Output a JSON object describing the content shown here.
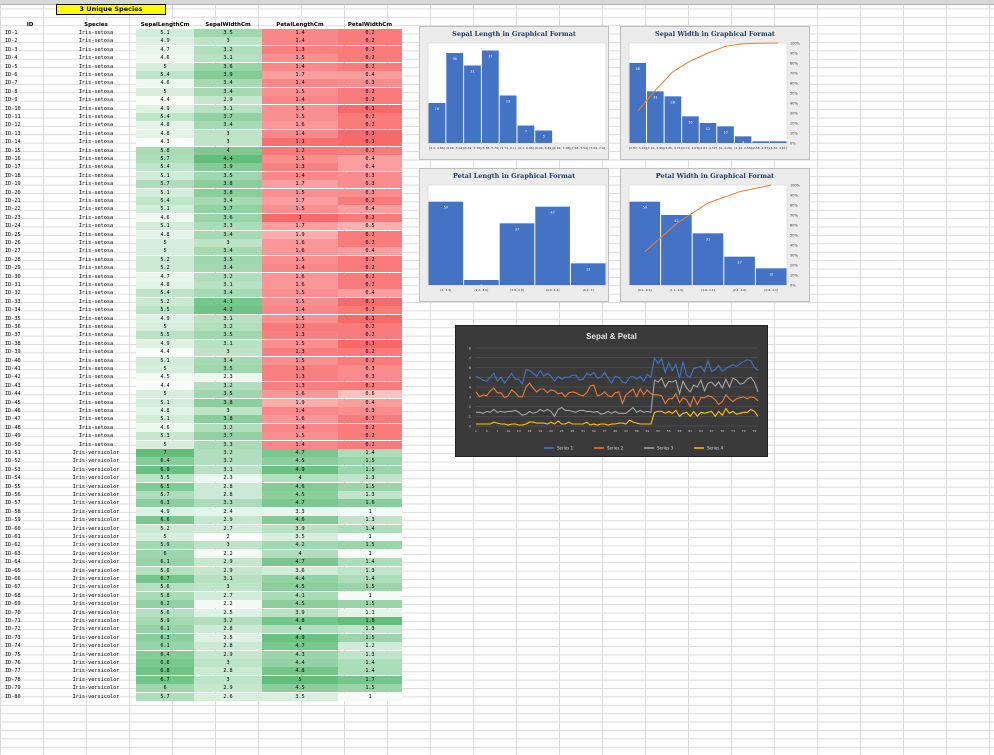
{
  "sheet": {
    "badge": "3 Unique Species",
    "headers": [
      "ID",
      "Species",
      "SepalLengthCm",
      "SepalWidthCm",
      "PetalLengthCm",
      "PetalWidthCm"
    ],
    "rows": [
      [
        "ID-1",
        "Iris-setosa",
        "5.1",
        "3.5",
        "1.4",
        "0.2"
      ],
      [
        "ID-2",
        "Iris-setosa",
        "4.9",
        "3",
        "1.4",
        "0.2"
      ],
      [
        "ID-3",
        "Iris-setosa",
        "4.7",
        "3.2",
        "1.3",
        "0.2"
      ],
      [
        "ID-4",
        "Iris-setosa",
        "4.6",
        "3.1",
        "1.5",
        "0.2"
      ],
      [
        "ID-5",
        "Iris-setosa",
        "5",
        "3.6",
        "1.4",
        "0.2"
      ],
      [
        "ID-6",
        "Iris-setosa",
        "5.4",
        "3.9",
        "1.7",
        "0.4"
      ],
      [
        "ID-7",
        "Iris-setosa",
        "4.6",
        "3.4",
        "1.4",
        "0.3"
      ],
      [
        "ID-8",
        "Iris-setosa",
        "5",
        "3.4",
        "1.5",
        "0.2"
      ],
      [
        "ID-9",
        "Iris-setosa",
        "4.4",
        "2.9",
        "1.4",
        "0.2"
      ],
      [
        "ID-10",
        "Iris-setosa",
        "4.9",
        "3.1",
        "1.5",
        "0.1"
      ],
      [
        "ID-11",
        "Iris-setosa",
        "5.4",
        "3.7",
        "1.5",
        "0.2"
      ],
      [
        "ID-12",
        "Iris-setosa",
        "4.8",
        "3.4",
        "1.6",
        "0.2"
      ],
      [
        "ID-13",
        "Iris-setosa",
        "4.8",
        "3",
        "1.4",
        "0.1"
      ],
      [
        "ID-14",
        "Iris-setosa",
        "4.3",
        "3",
        "1.1",
        "0.1"
      ],
      [
        "ID-15",
        "Iris-setosa",
        "5.8",
        "4",
        "1.2",
        "0.2"
      ],
      [
        "ID-16",
        "Iris-setosa",
        "5.7",
        "4.4",
        "1.5",
        "0.4"
      ],
      [
        "ID-17",
        "Iris-setosa",
        "5.4",
        "3.9",
        "1.3",
        "0.4"
      ],
      [
        "ID-18",
        "Iris-setosa",
        "5.1",
        "3.5",
        "1.4",
        "0.3"
      ],
      [
        "ID-19",
        "Iris-setosa",
        "5.7",
        "3.8",
        "1.7",
        "0.3"
      ],
      [
        "ID-20",
        "Iris-setosa",
        "5.1",
        "3.8",
        "1.5",
        "0.3"
      ],
      [
        "ID-21",
        "Iris-setosa",
        "5.4",
        "3.4",
        "1.7",
        "0.2"
      ],
      [
        "ID-22",
        "Iris-setosa",
        "5.1",
        "3.7",
        "1.5",
        "0.4"
      ],
      [
        "ID-23",
        "Iris-setosa",
        "4.6",
        "3.6",
        "1",
        "0.2"
      ],
      [
        "ID-24",
        "Iris-setosa",
        "5.1",
        "3.3",
        "1.7",
        "0.5"
      ],
      [
        "ID-25",
        "Iris-setosa",
        "4.8",
        "3.4",
        "1.9",
        "0.2"
      ],
      [
        "ID-26",
        "Iris-setosa",
        "5",
        "3",
        "1.6",
        "0.2"
      ],
      [
        "ID-27",
        "Iris-setosa",
        "5",
        "3.4",
        "1.6",
        "0.4"
      ],
      [
        "ID-28",
        "Iris-setosa",
        "5.2",
        "3.5",
        "1.5",
        "0.2"
      ],
      [
        "ID-29",
        "Iris-setosa",
        "5.2",
        "3.4",
        "1.4",
        "0.2"
      ],
      [
        "ID-30",
        "Iris-setosa",
        "4.7",
        "3.2",
        "1.6",
        "0.2"
      ],
      [
        "ID-31",
        "Iris-setosa",
        "4.8",
        "3.1",
        "1.6",
        "0.2"
      ],
      [
        "ID-32",
        "Iris-setosa",
        "5.4",
        "3.4",
        "1.5",
        "0.4"
      ],
      [
        "ID-33",
        "Iris-setosa",
        "5.2",
        "4.1",
        "1.5",
        "0.1"
      ],
      [
        "ID-34",
        "Iris-setosa",
        "5.5",
        "4.2",
        "1.4",
        "0.2"
      ],
      [
        "ID-35",
        "Iris-setosa",
        "4.9",
        "3.1",
        "1.5",
        "0.1"
      ],
      [
        "ID-36",
        "Iris-setosa",
        "5",
        "3.2",
        "1.2",
        "0.2"
      ],
      [
        "ID-37",
        "Iris-setosa",
        "5.5",
        "3.5",
        "1.3",
        "0.2"
      ],
      [
        "ID-38",
        "Iris-setosa",
        "4.9",
        "3.1",
        "1.5",
        "0.1"
      ],
      [
        "ID-39",
        "Iris-setosa",
        "4.4",
        "3",
        "1.3",
        "0.2"
      ],
      [
        "ID-40",
        "Iris-setosa",
        "5.1",
        "3.4",
        "1.5",
        "0.2"
      ],
      [
        "ID-41",
        "Iris-setosa",
        "5",
        "3.5",
        "1.3",
        "0.3"
      ],
      [
        "ID-42",
        "Iris-setosa",
        "4.5",
        "2.3",
        "1.3",
        "0.3"
      ],
      [
        "ID-43",
        "Iris-setosa",
        "4.4",
        "3.2",
        "1.3",
        "0.2"
      ],
      [
        "ID-44",
        "Iris-setosa",
        "5",
        "3.5",
        "1.6",
        "0.6"
      ],
      [
        "ID-45",
        "Iris-setosa",
        "5.1",
        "3.8",
        "1.9",
        "0.4"
      ],
      [
        "ID-46",
        "Iris-setosa",
        "4.8",
        "3",
        "1.4",
        "0.3"
      ],
      [
        "ID-47",
        "Iris-setosa",
        "5.1",
        "3.8",
        "1.6",
        "0.2"
      ],
      [
        "ID-48",
        "Iris-setosa",
        "4.6",
        "3.2",
        "1.4",
        "0.2"
      ],
      [
        "ID-49",
        "Iris-setosa",
        "5.3",
        "3.7",
        "1.5",
        "0.2"
      ],
      [
        "ID-50",
        "Iris-setosa",
        "5",
        "3.3",
        "1.4",
        "0.2"
      ],
      [
        "ID-51",
        "Iris-versicolor",
        "7",
        "3.2",
        "4.7",
        "1.4"
      ],
      [
        "ID-52",
        "Iris-versicolor",
        "6.4",
        "3.2",
        "4.5",
        "1.5"
      ],
      [
        "ID-53",
        "Iris-versicolor",
        "6.9",
        "3.1",
        "4.9",
        "1.5"
      ],
      [
        "ID-54",
        "Iris-versicolor",
        "5.5",
        "2.3",
        "4",
        "1.3"
      ],
      [
        "ID-55",
        "Iris-versicolor",
        "6.5",
        "2.8",
        "4.6",
        "1.5"
      ],
      [
        "ID-56",
        "Iris-versicolor",
        "5.7",
        "2.8",
        "4.5",
        "1.3"
      ],
      [
        "ID-57",
        "Iris-versicolor",
        "6.3",
        "3.3",
        "4.7",
        "1.6"
      ],
      [
        "ID-58",
        "Iris-versicolor",
        "4.9",
        "2.4",
        "3.3",
        "1"
      ],
      [
        "ID-59",
        "Iris-versicolor",
        "6.6",
        "2.9",
        "4.6",
        "1.3"
      ],
      [
        "ID-60",
        "Iris-versicolor",
        "5.2",
        "2.7",
        "3.9",
        "1.4"
      ],
      [
        "ID-61",
        "Iris-versicolor",
        "5",
        "2",
        "3.5",
        "1"
      ],
      [
        "ID-62",
        "Iris-versicolor",
        "5.9",
        "3",
        "4.2",
        "1.5"
      ],
      [
        "ID-63",
        "Iris-versicolor",
        "6",
        "2.2",
        "4",
        "1"
      ],
      [
        "ID-64",
        "Iris-versicolor",
        "6.1",
        "2.9",
        "4.7",
        "1.4"
      ],
      [
        "ID-65",
        "Iris-versicolor",
        "5.6",
        "2.9",
        "3.6",
        "1.3"
      ],
      [
        "ID-66",
        "Iris-versicolor",
        "6.7",
        "3.1",
        "4.4",
        "1.4"
      ],
      [
        "ID-67",
        "Iris-versicolor",
        "5.6",
        "3",
        "4.5",
        "1.5"
      ],
      [
        "ID-68",
        "Iris-versicolor",
        "5.8",
        "2.7",
        "4.1",
        "1"
      ],
      [
        "ID-69",
        "Iris-versicolor",
        "6.2",
        "2.2",
        "4.5",
        "1.5"
      ],
      [
        "ID-70",
        "Iris-versicolor",
        "5.6",
        "2.5",
        "3.9",
        "1.1"
      ],
      [
        "ID-71",
        "Iris-versicolor",
        "5.9",
        "3.2",
        "4.8",
        "1.8"
      ],
      [
        "ID-72",
        "Iris-versicolor",
        "6.1",
        "2.8",
        "4",
        "1.3"
      ],
      [
        "ID-73",
        "Iris-versicolor",
        "6.3",
        "2.5",
        "4.9",
        "1.5"
      ],
      [
        "ID-74",
        "Iris-versicolor",
        "6.1",
        "2.8",
        "4.7",
        "1.2"
      ],
      [
        "ID-75",
        "Iris-versicolor",
        "6.4",
        "2.9",
        "4.3",
        "1.3"
      ],
      [
        "ID-76",
        "Iris-versicolor",
        "6.6",
        "3",
        "4.4",
        "1.4"
      ],
      [
        "ID-77",
        "Iris-versicolor",
        "6.8",
        "2.8",
        "4.8",
        "1.4"
      ],
      [
        "ID-78",
        "Iris-versicolor",
        "6.7",
        "3",
        "5",
        "1.7"
      ],
      [
        "ID-79",
        "Iris-versicolor",
        "6",
        "2.9",
        "4.5",
        "1.5"
      ],
      [
        "ID-80",
        "Iris-versicolor",
        "5.7",
        "2.6",
        "3.5",
        "1"
      ]
    ]
  },
  "chart_data": [
    {
      "type": "bar",
      "title": "Sepal Length in Graphical Format",
      "categories": [
        "[4.3, 4.66]",
        "(4.66, 5.02]",
        "(5.02, 5.38]",
        "(5.38, 5.74]",
        "(5.74, 6.1]",
        "(6.1, 6.46]",
        "(6.46, 6.82]",
        "(6.82, 7.18]",
        "(7.18, 7.54]",
        "(7.54, 7.9]"
      ],
      "values": [
        16,
        36,
        31,
        37,
        19,
        7,
        5,
        0,
        0,
        0
      ],
      "ylim": [
        0,
        40
      ]
    },
    {
      "type": "bar",
      "title": "Sepal Width in Graphical Format",
      "categories": [
        "[2.87, 3.16]",
        "[3.16, 3.45]",
        "(3.45, 3.74]",
        "(3.74, 4.03]",
        "(4.03, 4.32]",
        "[2, 2.29]",
        "(2.29, 2.58]",
        "(2.58, 2.87]",
        "(4.32, 4.61]"
      ],
      "values": [
        48,
        31,
        28,
        16,
        12,
        10,
        4,
        1,
        1
      ],
      "cumulative_percent": [
        32,
        52.7,
        71.3,
        82,
        90,
        96.7,
        99.3,
        99.7,
        100
      ],
      "ylim": [
        0,
        60
      ]
    },
    {
      "type": "bar",
      "title": "Petal Length in Graphical Format",
      "categories": [
        "[1, 2.3]",
        "(2.3, 3.6]",
        "(3.6, 4.9]",
        "(4.9, 6.2]",
        "(6.2, 7]"
      ],
      "values": [
        50,
        3,
        37,
        47,
        13
      ],
      "ylim": [
        0,
        60
      ]
    },
    {
      "type": "bar",
      "title": "Petal Width in Graphical Format",
      "categories": [
        "[0.1, 0.6]",
        "(1.1, 1.6]",
        "(1.6, 2.1]",
        "(2.1, 2.6]",
        "(0.6, 1.1]"
      ],
      "values": [
        50,
        42,
        31,
        17,
        10
      ],
      "cumulative_percent": [
        33.3,
        61.3,
        82,
        93.3,
        100
      ],
      "ylim": [
        0,
        60
      ]
    },
    {
      "type": "line",
      "title": "Sepal & Petal",
      "ylim": [
        0,
        8
      ],
      "series": [
        {
          "name": "Series 1",
          "color": "#4472c4"
        },
        {
          "name": "Series 2",
          "color": "#ed7d31"
        },
        {
          "name": "Series 3",
          "color": "#a5a5a5"
        },
        {
          "name": "Series 4",
          "color": "#ffc000"
        }
      ]
    }
  ],
  "pct_ticks": [
    "100%",
    "90%",
    "80%",
    "70%",
    "60%",
    "50%",
    "40%",
    "30%",
    "20%",
    "10%",
    "0%"
  ],
  "colors": {
    "green": "#63be7b",
    "red": "#f8696b",
    "bar": "#4472c4",
    "line": "#ed7d31"
  }
}
